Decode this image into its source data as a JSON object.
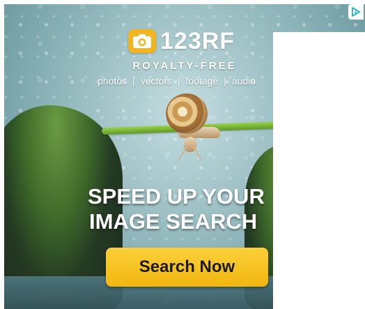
{
  "ad": {
    "brand": "123RF",
    "tagline": "ROYALTY-FREE",
    "media_types": [
      "photos",
      "vectors",
      "footage",
      "audio"
    ],
    "media_separator": "|",
    "headline": [
      "SPEED UP YOUR",
      "IMAGE SEARCH"
    ],
    "cta_label": "Search Now"
  },
  "colors": {
    "accent": "#f3b51e",
    "cta": "#f2b60f",
    "adchoices": "#00aecd"
  },
  "icons": {
    "logo": "camera-icon",
    "adchoices": "adchoices-icon"
  }
}
